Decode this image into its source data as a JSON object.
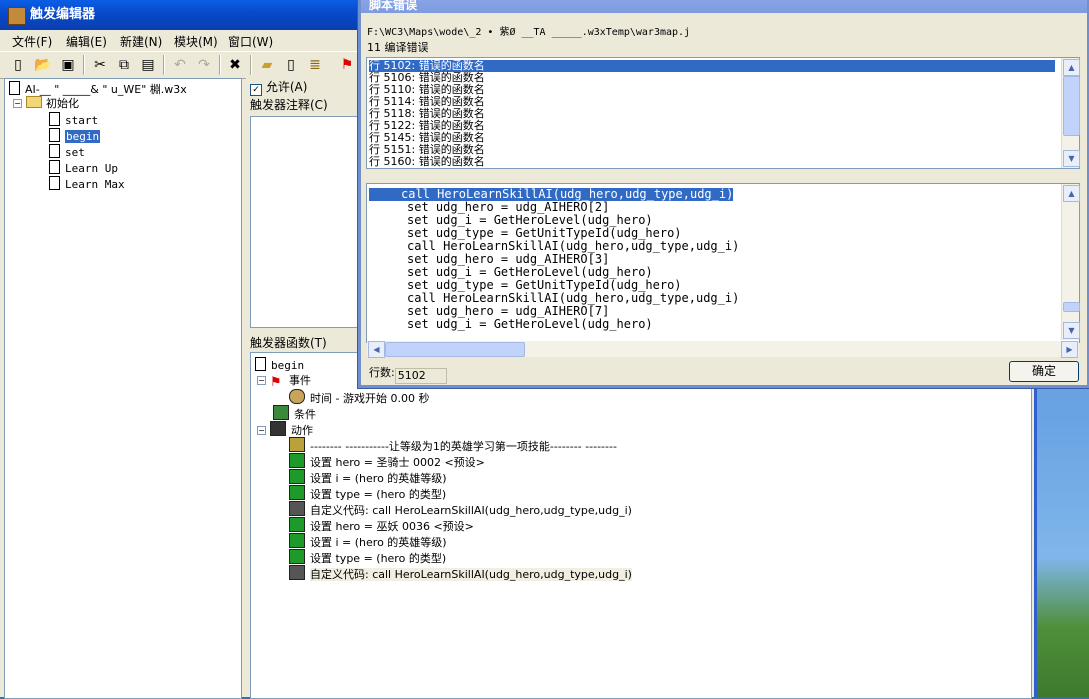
{
  "editor": {
    "title": "触发编辑器",
    "menus": [
      "文件(F)",
      "编辑(E)",
      "新建(N)",
      "模块(M)",
      "窗口(W)"
    ],
    "toolbar_icons": [
      "new-icon",
      "open-icon",
      "save-icon",
      "cut-icon",
      "copy-icon",
      "paste-icon",
      "undo-icon",
      "redo-icon",
      "close-icon",
      "new-category-icon",
      "new-trigger-icon",
      "new-comment-icon",
      "new-event-icon"
    ]
  },
  "tree": {
    "root": "AI-__ \" _____& \" u_WE\" 棩.w3x",
    "category": "初始化",
    "triggers": [
      "start",
      "begin",
      "set",
      "Learn Up",
      "Learn Max"
    ],
    "selected": "begin"
  },
  "trigger_panel": {
    "enabled_label": "允许(A)",
    "comment_label": "触发器注释(C)",
    "functions_label": "触发器函数(T)"
  },
  "functions": {
    "trigger_name": "begin",
    "events_label": "事件",
    "event_item": "时间 - 游戏开始 0.00 秒",
    "conditions_label": "条件",
    "actions_label": "动作",
    "actions": [
      {
        "icon": "comment",
        "text": "-------- -----------让等级为1的英雄学习第一项技能-------- --------"
      },
      {
        "icon": "set",
        "text": "设置 hero = 圣骑士 0002 <预设>"
      },
      {
        "icon": "set",
        "text": "设置 i = (hero 的英雄等级)"
      },
      {
        "icon": "set",
        "text": "设置 type = (hero 的类型)"
      },
      {
        "icon": "code",
        "text": "自定义代码: call HeroLearnSkillAI(udg_hero,udg_type,udg_i)"
      },
      {
        "icon": "set",
        "text": "设置 hero = 巫妖 0036 <预设>"
      },
      {
        "icon": "set",
        "text": "设置 i = (hero 的英雄等级)"
      },
      {
        "icon": "set",
        "text": "设置 type = (hero 的类型)"
      },
      {
        "icon": "code",
        "text": "自定义代码: call HeroLearnSkillAI(udg_hero,udg_type,udg_i)"
      }
    ]
  },
  "dialog": {
    "title": "脚本错误",
    "path": "F:\\WC3\\Maps\\wode\\_2 • 紫Ø __TA _____.w3xTemp\\war3map.j",
    "error_count": "11 编译错误",
    "errors": [
      "行 5102: 错误的函数名",
      "行 5106: 错误的函数名",
      "行 5110: 错误的函数名",
      "行 5114: 错误的函数名",
      "行 5118: 错误的函数名",
      "行 5122: 错误的函数名",
      "行 5145: 错误的函数名",
      "行 5151: 错误的函数名",
      "行 5160: 错误的函数名"
    ],
    "code_lines": [
      "call HeroLearnSkillAI(udg_hero,udg_type,udg_i)",
      "set udg_hero = udg_AIHERO[2]",
      "set udg_i = GetHeroLevel(udg_hero)",
      "set udg_type = GetUnitTypeId(udg_hero)",
      "call HeroLearnSkillAI(udg_hero,udg_type,udg_i)",
      "set udg_hero = udg_AIHERO[3]",
      "set udg_i = GetHeroLevel(udg_hero)",
      "set udg_type = GetUnitTypeId(udg_hero)",
      "call HeroLearnSkillAI(udg_hero,udg_type,udg_i)",
      "set udg_hero = udg_AIHERO[7]",
      "set udg_i = GetHeroLevel(udg_hero)"
    ],
    "line_label": "行数:",
    "line_value": "5102",
    "ok_label": "确定"
  }
}
